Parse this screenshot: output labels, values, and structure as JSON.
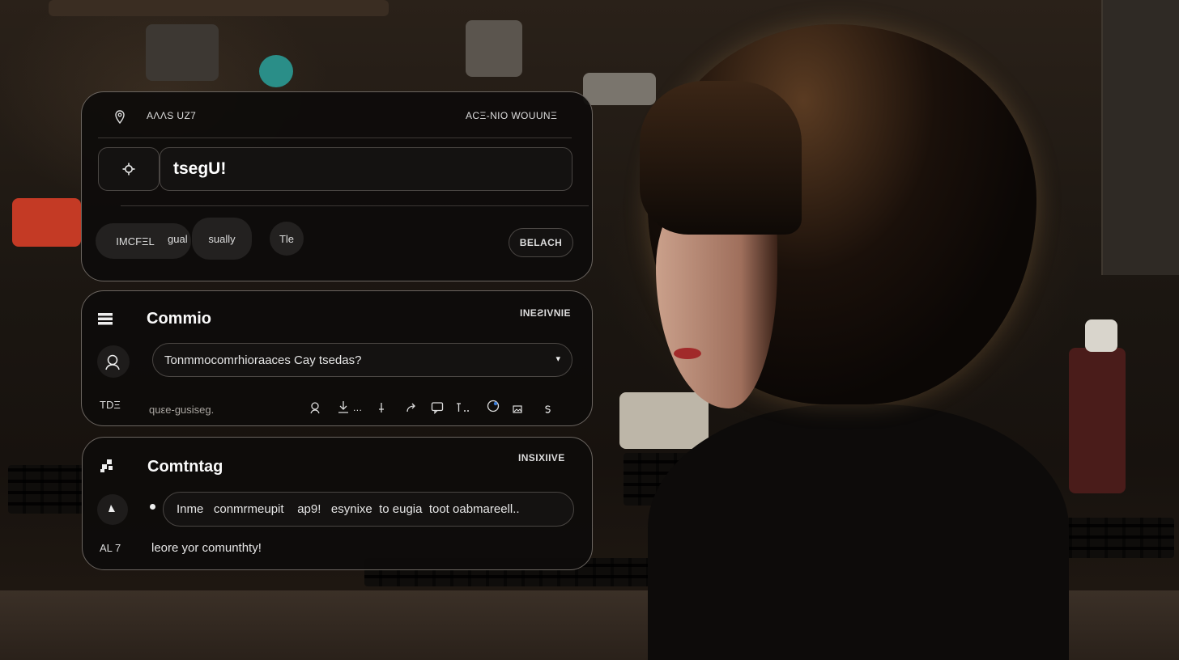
{
  "card1": {
    "header_left": "AΛΛS UZ7",
    "header_right": "ACΞ-NIO WOUUNΞ",
    "input_value": "tsegU!",
    "chips": [
      "IMCFΞL",
      "gual",
      "sually",
      "Tle"
    ],
    "action_button": "BELACH"
  },
  "card2": {
    "title": "Commio",
    "badge": "INEƧIVNIE",
    "select_value": "Tonmmocomrhioraaces Cay  tsedas?",
    "footer_left": "TDΞ",
    "footer_hint": "quεe-gusiseg.",
    "toolbar_tail": [
      "...",
      "!",
      "r..."
    ]
  },
  "card3": {
    "title": "Comtntag",
    "badge": "INSIXIIVE",
    "message": "Inme   conmrmeupit    ap9!   esynixe  to eugia  toot oabmareell..",
    "footer_left": "AL 7",
    "footer_text": "leore yor comunthty!"
  },
  "colors": {
    "card_bg": "#0e0c0b",
    "card_border": "#6b6560",
    "chip_bg": "#232120"
  }
}
